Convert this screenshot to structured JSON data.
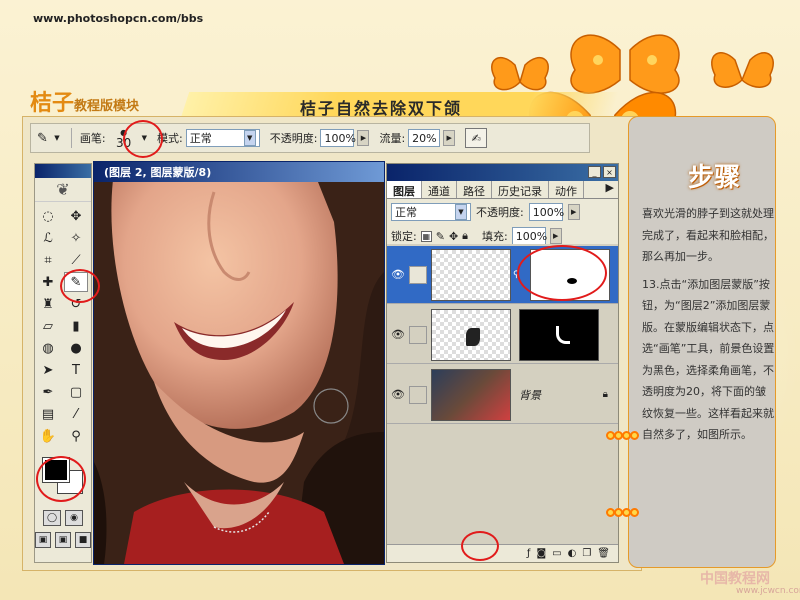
{
  "header": {
    "site_url": "www.photoshopcn.com/bbs",
    "brand_main": "桔子",
    "brand_sub": "教程版模块",
    "title": "桔子自然去除双下颌"
  },
  "options_bar": {
    "brush_label": "画笔:",
    "brush_size": "30",
    "mode_label": "模式:",
    "mode_value": "正常",
    "opacity_label": "不透明度:",
    "opacity_value": "100%",
    "flow_label": "流量:",
    "flow_value": "20%"
  },
  "document": {
    "title": "(图层 2, 图层蒙版/8)"
  },
  "layers_panel": {
    "tabs": [
      "图层",
      "通道",
      "路径",
      "历史记录",
      "动作"
    ],
    "blend_mode": "正常",
    "opacity_label": "不透明度:",
    "opacity_value": "100%",
    "lock_label": "锁定:",
    "fill_label": "填充:",
    "fill_value": "100%",
    "background_label": "背景"
  },
  "step_panel": {
    "title": "步骤",
    "paragraph1": "喜欢光滑的脖子到这就处理完成了，看起来和脸相配，那么再加一步。",
    "paragraph2": "13.点击“添加图层蒙版”按钮，为“图层2”添加图层蒙版。在蒙版编辑状态下，点选“画笔”工具，前景色设置为黑色，选择柔角画笔，不透明度为20，将下面的皱纹恢复一些。这样看起来就自然多了，如图所示。"
  },
  "footer": {
    "logo": "中国教程网",
    "sub": "www.jcwcn.com"
  },
  "colors": {
    "accent": "#e38a12",
    "ring": "#e11b1b",
    "panel": "#cfcbc4"
  }
}
